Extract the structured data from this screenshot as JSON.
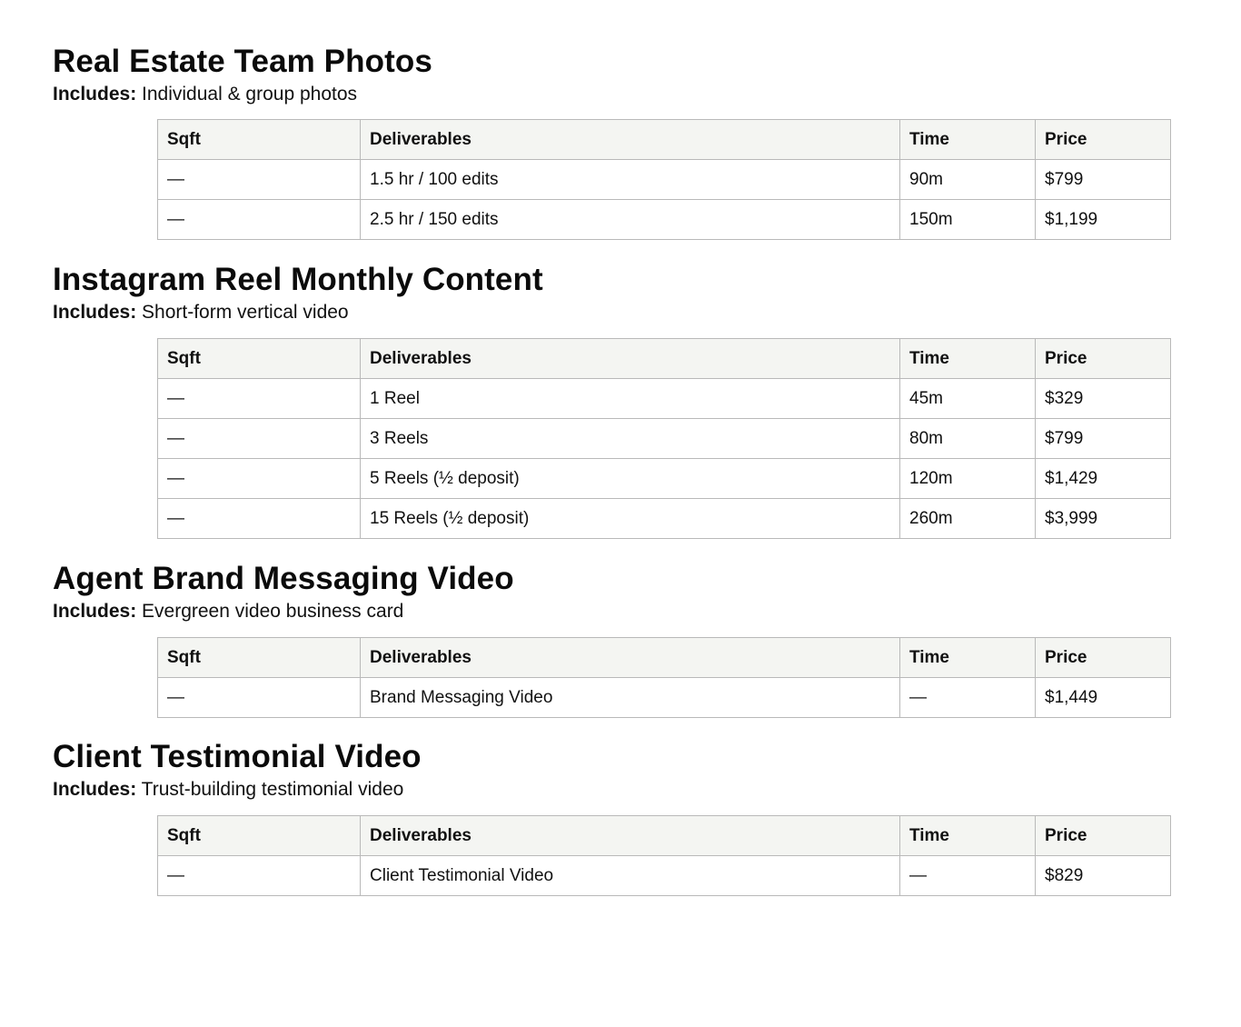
{
  "columns": [
    "Sqft",
    "Deliverables",
    "Time",
    "Price"
  ],
  "includes_label": "Includes:",
  "sections": [
    {
      "title": "Real Estate Team Photos",
      "includes": "Individual & group photos",
      "rows": [
        [
          "—",
          "1.5 hr / 100 edits",
          "90m",
          "$799"
        ],
        [
          "—",
          "2.5 hr / 150 edits",
          "150m",
          "$1,199"
        ]
      ]
    },
    {
      "title": "Instagram Reel Monthly Content",
      "includes": "Short-form vertical video",
      "rows": [
        [
          "—",
          "1 Reel",
          "45m",
          "$329"
        ],
        [
          "—",
          "3 Reels",
          "80m",
          "$799"
        ],
        [
          "—",
          "5 Reels (½ deposit)",
          "120m",
          "$1,429"
        ],
        [
          "—",
          "15 Reels (½ deposit)",
          "260m",
          "$3,999"
        ]
      ]
    },
    {
      "title": "Agent Brand Messaging Video",
      "includes": "Evergreen video business card",
      "rows": [
        [
          "—",
          "Brand Messaging Video",
          "—",
          "$1,449"
        ]
      ]
    },
    {
      "title": "Client Testimonial Video",
      "includes": "Trust-building testimonial video",
      "rows": [
        [
          "—",
          "Client Testimonial Video",
          "—",
          "$829"
        ]
      ]
    }
  ]
}
